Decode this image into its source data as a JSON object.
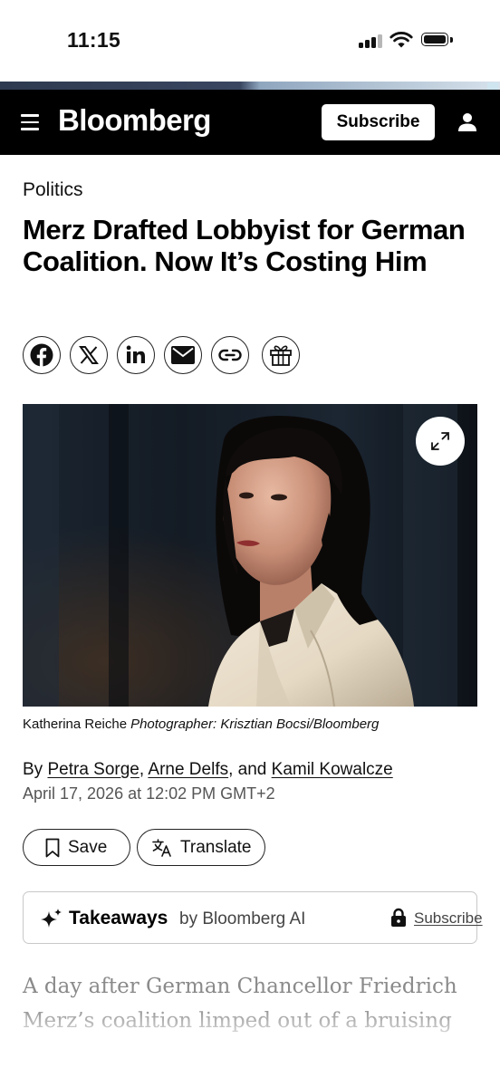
{
  "status_bar": {
    "time": "11:15"
  },
  "header": {
    "logo": "Bloomberg",
    "subscribe_label": "Subscribe",
    "background": "#000000"
  },
  "article": {
    "category": "Politics",
    "headline": "Merz Drafted Lobbyist for German Coalition. Now It’s Costing Him",
    "share_icons": [
      "facebook-icon",
      "x-icon",
      "linkedin-icon",
      "email-icon",
      "link-icon",
      "gift-icon"
    ],
    "image_caption": "Katherina Reiche",
    "image_credit": "Photographer: Krisztian Bocsi/Bloomberg",
    "byline": {
      "prefix": "By",
      "authors": [
        "Petra Sorge",
        "Arne Delfs",
        "Kamil Kowalcze"
      ],
      "sep1": ",",
      "sep2": ", and"
    },
    "date": "April 17, 2026 at 12:02 PM GMT+2",
    "save_label": "Save",
    "translate_label": "Translate",
    "takeaways": {
      "title": "Takeaways",
      "by": "by Bloomberg AI",
      "subscribe": "Subscribe"
    },
    "body_lines": [
      "A day after German Chancellor Friedrich",
      "Merz’s coalition limped out of a bruising"
    ]
  }
}
